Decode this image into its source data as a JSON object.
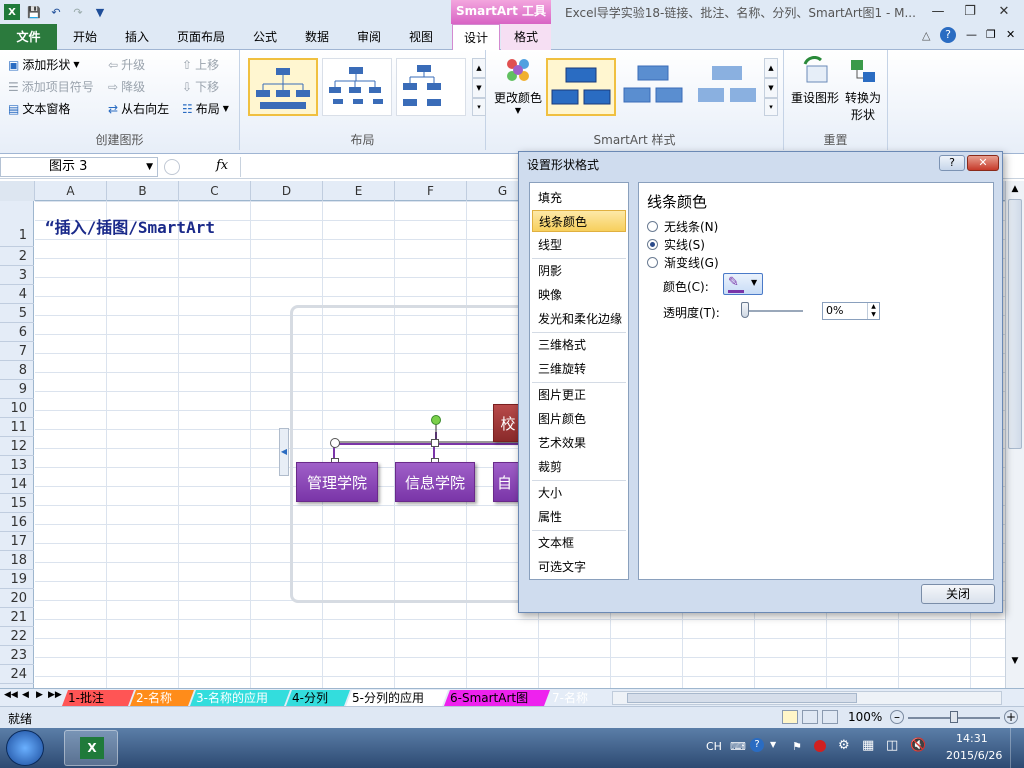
{
  "window": {
    "title": "Excel导学实验18-链接、批注、名称、分列、SmartArt图1 - M...",
    "context_tab": "SmartArt 工具"
  },
  "ribbon_tabs": [
    "文件",
    "开始",
    "插入",
    "页面布局",
    "公式",
    "数据",
    "审阅",
    "视图",
    "设计",
    "格式"
  ],
  "ribbon": {
    "create_group": {
      "label": "创建图形",
      "add_shape": "添加形状",
      "add_bullet": "添加项目符号",
      "text_pane": "文本窗格",
      "promote": "升级",
      "demote": "降级",
      "right_to_left": "从右向左",
      "move_up": "上移",
      "move_down": "下移",
      "layout": "布局"
    },
    "layouts_group": {
      "label": "布局"
    },
    "styles_group": {
      "label": "SmartArt 样式",
      "change_colors": "更改颜色"
    },
    "reset_group": {
      "label": "重置",
      "reset_graphic": "重设图形",
      "convert_line1": "转换为",
      "convert_line2": "形状"
    }
  },
  "formula_bar": {
    "name_box": "图示 3",
    "fx": "fx",
    "value": ""
  },
  "columns": [
    "A",
    "B",
    "C",
    "D",
    "E",
    "F",
    "G"
  ],
  "rows": [
    "1",
    "2",
    "3",
    "4",
    "5",
    "6",
    "7",
    "8",
    "9",
    "10",
    "11",
    "12",
    "13",
    "14",
    "15",
    "16",
    "17",
    "18",
    "19",
    "20",
    "21",
    "22",
    "23",
    "24"
  ],
  "cell_a1": "“插入/插图/SmartArt",
  "smartart": {
    "top_box": "校",
    "boxes": [
      "管理学院",
      "信息学院",
      "自动"
    ]
  },
  "sheet_tabs": [
    {
      "label": "1-批注",
      "color": "#22dd22"
    },
    {
      "label": "2-名称",
      "color": "#ff5555"
    },
    {
      "label": "3-名称的应用",
      "color": "#ff8c1a"
    },
    {
      "label": "4-分列",
      "color": "#33dddd"
    },
    {
      "label": "5-分列的应用",
      "color": "#33dddd"
    },
    {
      "label": "6-SmartArt图",
      "color": "#ffffff"
    },
    {
      "label": "7-名称",
      "color": "#ee22ee"
    }
  ],
  "status": {
    "ready": "就绪",
    "zoom": "100%"
  },
  "taskbar": {
    "lang": "CH",
    "time": "14:31",
    "date": "2015/6/26"
  },
  "dialog": {
    "title": "设置形状格式",
    "help": "?",
    "nav_items": [
      "填充",
      "线条颜色",
      "线型",
      "阴影",
      "映像",
      "发光和柔化边缘",
      "三维格式",
      "三维旋转",
      "图片更正",
      "图片颜色",
      "艺术效果",
      "裁剪",
      "大小",
      "属性",
      "文本框",
      "可选文字"
    ],
    "selected_nav": "线条颜色",
    "panel_title": "线条颜色",
    "options": [
      {
        "label": "无线条(N)",
        "checked": false
      },
      {
        "label": "实线(S)",
        "checked": true
      },
      {
        "label": "渐变线(G)",
        "checked": false
      }
    ],
    "color_label": "颜色(C):",
    "transparency_label": "透明度(T):",
    "transparency_value": "0%",
    "close_button": "关闭"
  }
}
